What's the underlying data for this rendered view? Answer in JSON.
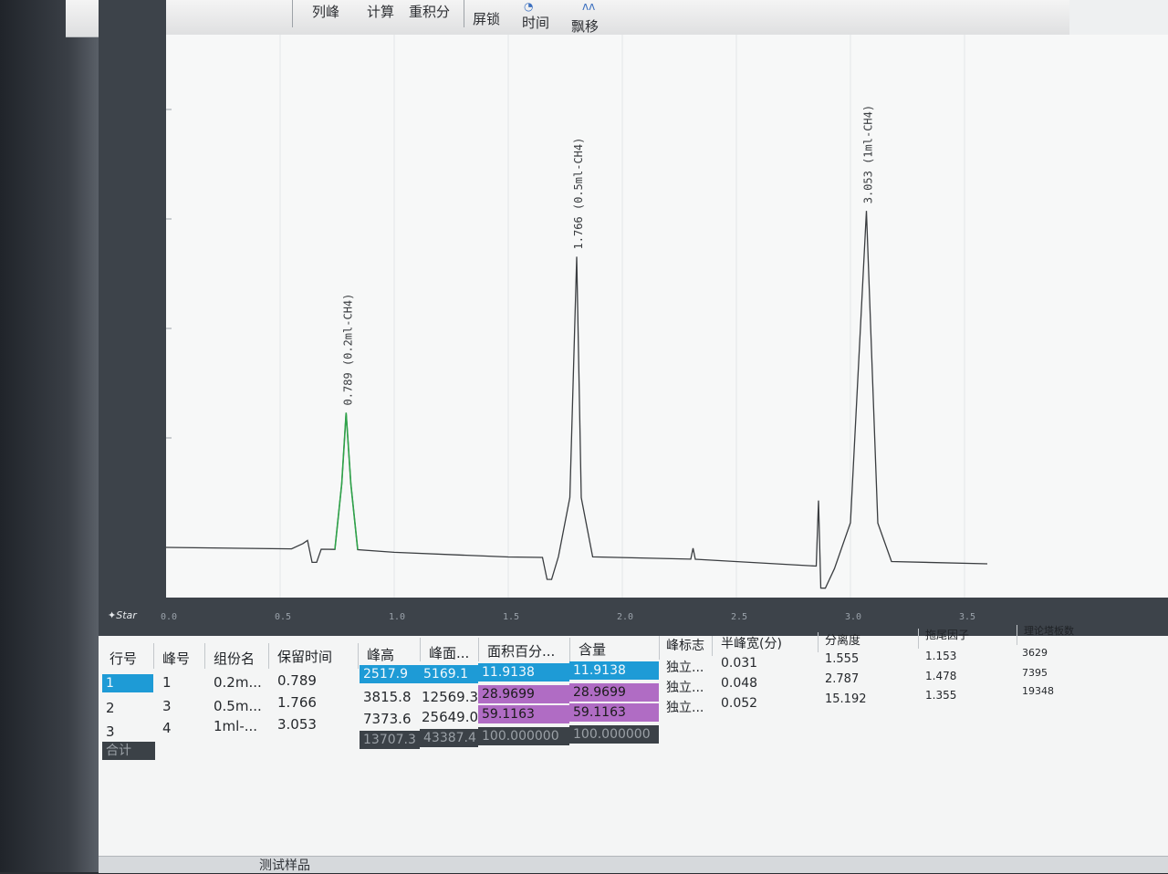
{
  "toolbar": {
    "items": [
      "列峰",
      "计算",
      "重积分",
      "屏锁",
      "时间",
      "飘移"
    ]
  },
  "chart_data": {
    "type": "line",
    "xlim": [
      0,
      3.6
    ],
    "ylim": [
      0,
      4.5
    ],
    "x_ticks": [
      "0.0",
      "0.5",
      "1.0",
      "1.5",
      "2.0",
      "2.5",
      "3.0",
      "3.5"
    ],
    "y_ticks": [
      "0",
      "1",
      "2",
      "3",
      "4"
    ],
    "peak_labels": [
      "0.789 (0.2ml-CH4)",
      "1.766 (0.5ml-CH4)",
      "3.053 (1ml-CH4)"
    ],
    "series": [
      {
        "points": [
          [
            0,
            0
          ],
          [
            0.55,
            0
          ],
          [
            0.6,
            0.05
          ],
          [
            0.62,
            0.08
          ],
          [
            0.64,
            -0.12
          ],
          [
            0.66,
            -0.12
          ],
          [
            0.68,
            0
          ],
          [
            0.74,
            0
          ],
          [
            0.77,
            0.6
          ],
          [
            0.789,
            1.25
          ],
          [
            0.81,
            0.6
          ],
          [
            0.84,
            0
          ],
          [
            1.0,
            -0.02
          ],
          [
            1.5,
            -0.05
          ],
          [
            1.65,
            -0.05
          ],
          [
            1.67,
            -0.25
          ],
          [
            1.69,
            -0.25
          ],
          [
            1.72,
            -0.04
          ],
          [
            1.77,
            0.5
          ],
          [
            1.8,
            2.7
          ],
          [
            1.82,
            0.5
          ],
          [
            1.87,
            -0.04
          ],
          [
            2.3,
            -0.05
          ],
          [
            2.31,
            0.05
          ],
          [
            2.32,
            -0.05
          ],
          [
            2.85,
            -0.1
          ],
          [
            2.86,
            0.5
          ],
          [
            2.87,
            -0.3
          ],
          [
            2.89,
            -0.3
          ],
          [
            2.93,
            -0.12
          ],
          [
            3.0,
            0.3
          ],
          [
            3.07,
            3.15
          ],
          [
            3.12,
            0.3
          ],
          [
            3.18,
            -0.05
          ],
          [
            3.6,
            -0.06
          ]
        ]
      }
    ]
  },
  "app": {
    "logo": "Star"
  },
  "table_left": {
    "headers": [
      "行号",
      "峰号",
      "组份名",
      "保留时间"
    ],
    "rows": [
      [
        "1",
        "1",
        "0.2m...",
        "0.789"
      ],
      [
        "2",
        "3",
        "0.5m...",
        "1.766"
      ],
      [
        "3",
        "4",
        "1ml-...",
        "3.053"
      ]
    ],
    "total_label": "合计"
  },
  "table_mid": {
    "headers": [
      "峰高",
      "峰面...",
      "面积百分...",
      "含量"
    ],
    "rows": [
      [
        "2517.9",
        "5169.1",
        "11.9138",
        "11.9138"
      ],
      [
        "3815.8",
        "12569.3",
        "28.9699",
        "28.9699"
      ],
      [
        "7373.6",
        "25649.0",
        "59.1163",
        "59.1163"
      ]
    ],
    "total": [
      "13707.3",
      "43387.4",
      "100.000000",
      "100.000000"
    ]
  },
  "table_right": {
    "headers": [
      "峰标志",
      "半峰宽(分)",
      "分离度",
      "拖尾因子",
      "理论塔板数"
    ],
    "rows": [
      [
        "独立...",
        "0.031",
        "1.555",
        "1.153",
        "3629"
      ],
      [
        "独立...",
        "0.048",
        "2.787",
        "1.478",
        "7395"
      ],
      [
        "独立...",
        "0.052",
        "15.192",
        "1.355",
        "19348"
      ]
    ]
  },
  "status": {
    "tab": "测试样品"
  },
  "colors": {
    "peak_highlight": "#2fa34a",
    "trace": "#3a3d40",
    "selected": "#1e9bd6",
    "purple": "#b06cc4"
  }
}
